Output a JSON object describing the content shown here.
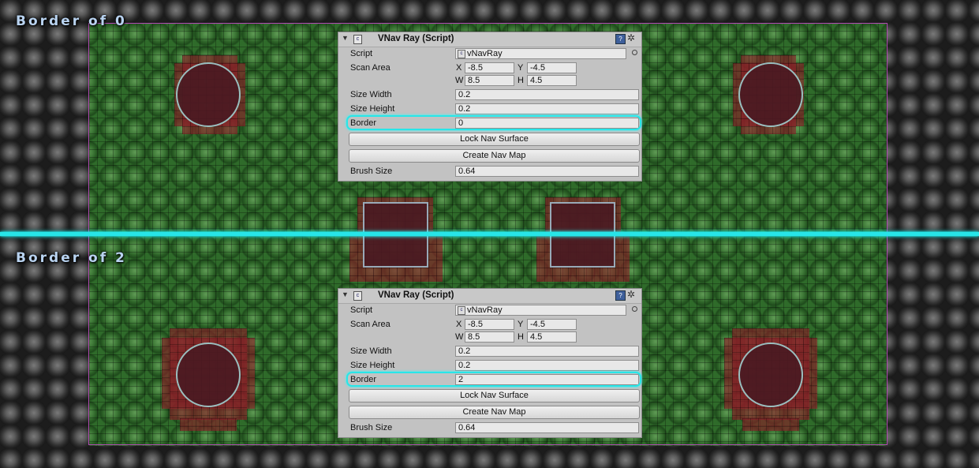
{
  "sections": [
    {
      "label": "Border of 0",
      "inspector": {
        "title": "VNav Ray (Script)",
        "script_label": "Script",
        "script_value": "vNavRay",
        "scan_area_label": "Scan Area",
        "x_label": "X",
        "x_value": "-8.5",
        "y_label": "Y",
        "y_value": "-4.5",
        "w_label": "W",
        "w_value": "8.5",
        "h_label": "H",
        "h_value": "4.5",
        "size_width_label": "Size Width",
        "size_width_value": "0.2",
        "size_height_label": "Size Height",
        "size_height_value": "0.2",
        "border_label": "Border",
        "border_value": "0",
        "lock_button": "Lock Nav Surface",
        "create_button": "Create Nav Map",
        "brush_size_label": "Brush Size",
        "brush_size_value": "0.64"
      }
    },
    {
      "label": "Border of 2",
      "inspector": {
        "title": "VNav Ray (Script)",
        "script_label": "Script",
        "script_value": "vNavRay",
        "scan_area_label": "Scan Area",
        "x_label": "X",
        "x_value": "-8.5",
        "y_label": "Y",
        "y_value": "-4.5",
        "w_label": "W",
        "w_value": "8.5",
        "h_label": "H",
        "h_value": "4.5",
        "size_width_label": "Size Width",
        "size_width_value": "0.2",
        "size_height_label": "Size Height",
        "size_height_value": "0.2",
        "border_label": "Border",
        "border_value": "2",
        "lock_button": "Lock Nav Surface",
        "create_button": "Create Nav Map",
        "brush_size_label": "Brush Size",
        "brush_size_value": "0.64"
      }
    }
  ],
  "colors": {
    "highlight": "#28e6e8",
    "scan_border": "#b24ab4",
    "walkable": "#2f6b2a",
    "blocked": "#8c1e28"
  }
}
